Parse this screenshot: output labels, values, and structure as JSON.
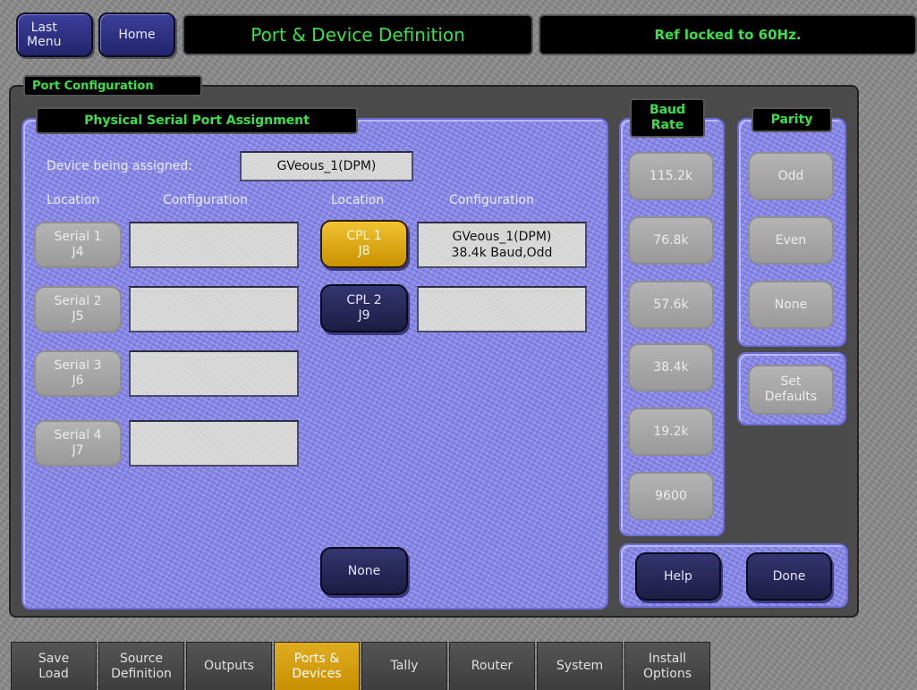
{
  "header": {
    "last_menu": "Last\nMenu",
    "home": "Home",
    "title": "Port & Device Definition",
    "status": "Ref locked to 60Hz."
  },
  "port_configuration": {
    "tab_label": "Port Configuration",
    "physical_panel": {
      "tab_label": "Physical Serial Port Assignment",
      "device_label": "Device being assigned:",
      "device_value": "GVeous_1(DPM)",
      "col_headers": [
        "Location",
        "Configuration",
        "Location",
        "Configuration"
      ],
      "serial_ports": [
        {
          "label": "Serial 1\nJ4",
          "config": ""
        },
        {
          "label": "Serial 2\nJ5",
          "config": ""
        },
        {
          "label": "Serial 3\nJ6",
          "config": ""
        },
        {
          "label": "Serial 4\nJ7",
          "config": ""
        }
      ],
      "cpl_ports": [
        {
          "label": "CPL 1\nJ8",
          "config": "GVeous_1(DPM)\n38.4k Baud,Odd",
          "selected": true
        },
        {
          "label": "CPL 2\nJ9",
          "config": "",
          "selected": false
        }
      ],
      "none_button": "None"
    },
    "baud_rate": {
      "tab_label": "Baud\nRate",
      "options": [
        "115.2k",
        "76.8k",
        "57.6k",
        "38.4k",
        "19.2k",
        "9600"
      ]
    },
    "parity": {
      "tab_label": "Parity",
      "options": [
        "Odd",
        "Even",
        "None"
      ]
    },
    "set_defaults": "Set\nDefaults",
    "help": "Help",
    "done": "Done"
  },
  "bottom_tabs": [
    {
      "label": "Save\nLoad",
      "active": false
    },
    {
      "label": "Source\nDefinition",
      "active": false
    },
    {
      "label": "Outputs",
      "active": false
    },
    {
      "label": "Ports &\nDevices",
      "active": true
    },
    {
      "label": "Tally",
      "active": false
    },
    {
      "label": "Router",
      "active": false
    },
    {
      "label": "System",
      "active": false
    },
    {
      "label": "Install\nOptions",
      "active": false
    }
  ],
  "colors": {
    "accent_green": "#39e04a",
    "panel_lavender": "#8a8aee",
    "selected_gold": "#e0ad20",
    "navy_button": "#22256c"
  }
}
